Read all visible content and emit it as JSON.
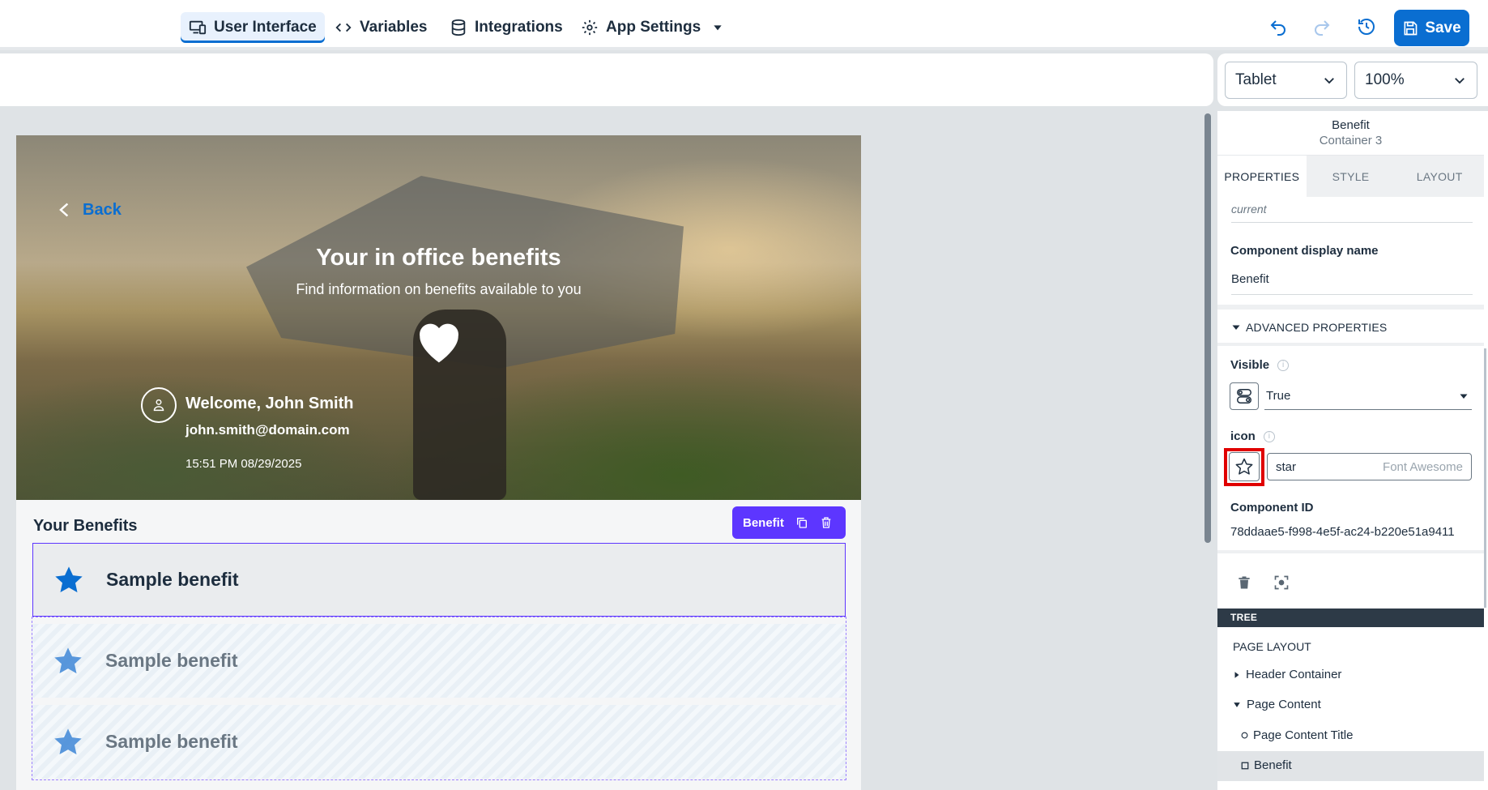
{
  "topbar": {
    "nav": [
      {
        "label": "User Interface",
        "icon": "devices-icon",
        "active": true
      },
      {
        "label": "Variables",
        "icon": "code-icon",
        "active": false
      },
      {
        "label": "Integrations",
        "icon": "database-icon",
        "active": false
      },
      {
        "label": "App Settings",
        "icon": "gear-icon",
        "active": false
      }
    ],
    "save_label": "Save"
  },
  "toolbar": {
    "device": "Tablet",
    "zoom": "100%"
  },
  "hero": {
    "back_label": "Back",
    "title": "Your in office benefits",
    "subtitle": "Find information on benefits available to you",
    "welcome": "Welcome, John Smith",
    "email": "john.smith@domain.com",
    "timestamp": "15:51 PM 08/29/2025"
  },
  "content": {
    "section_title": "Your Benefits",
    "chip_label": "Benefit",
    "benefits": [
      {
        "label": "Sample benefit"
      },
      {
        "label": "Sample benefit"
      },
      {
        "label": "Sample benefit"
      }
    ]
  },
  "panel": {
    "component_name": "Benefit",
    "component_parent": "Container 3",
    "tabs": [
      "PROPERTIES",
      "STYLE",
      "LAYOUT"
    ],
    "current_placeholder": "current",
    "display_name_label": "Component display name",
    "display_name_value": "Benefit",
    "advanced_label": "ADVANCED PROPERTIES",
    "visible_label": "Visible",
    "visible_value": "True",
    "icon_label": "icon",
    "icon_value": "star",
    "icon_library": "Font Awesome",
    "component_id_label": "Component ID",
    "component_id_value": "78ddaae5-f998-4e5f-ac24-b220e51a9411",
    "tree_header": "TREE",
    "tree": {
      "root": "PAGE LAYOUT",
      "header_container": "Header Container",
      "page_content": "Page Content",
      "page_content_title": "Page Content Title",
      "benefit": "Benefit"
    }
  },
  "colors": {
    "accent": "#0a6ed1",
    "selection": "#5d36ff",
    "highlight": "#e00000"
  }
}
